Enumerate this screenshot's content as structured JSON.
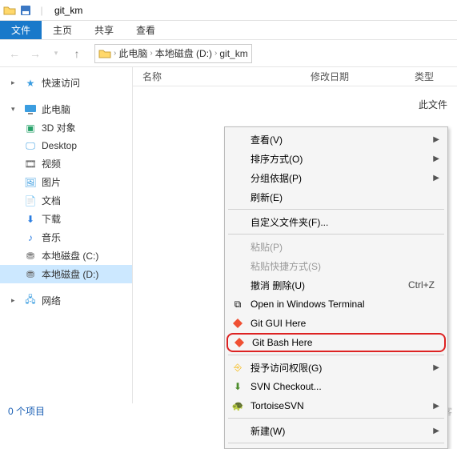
{
  "title": "git_km",
  "ribbon": {
    "file": "文件",
    "home": "主页",
    "share": "共享",
    "view": "查看"
  },
  "breadcrumb": {
    "pc": "此电脑",
    "disk": "本地磁盘 (D:)",
    "folder": "git_km"
  },
  "columns": {
    "name": "名称",
    "date": "修改日期",
    "type": "类型"
  },
  "empty": "此文件",
  "sidebar": {
    "quick": "快速访问",
    "pc": "此电脑",
    "items": [
      "3D 对象",
      "Desktop",
      "视频",
      "图片",
      "文档",
      "下载",
      "音乐",
      "本地磁盘 (C:)",
      "本地磁盘 (D:)"
    ],
    "network": "网络"
  },
  "status": "0 个项目",
  "watermark": "@51CTO博客",
  "menu": {
    "view": "查看(V)",
    "sort": "排序方式(O)",
    "group": "分组依据(P)",
    "refresh": "刷新(E)",
    "custom": "自定义文件夹(F)...",
    "paste": "粘贴(P)",
    "pasteShortcut": "粘贴快捷方式(S)",
    "undo": "撤消 删除(U)",
    "undoKey": "Ctrl+Z",
    "openTerminal": "Open in Windows Terminal",
    "gitGui": "Git GUI Here",
    "gitBash": "Git Bash Here",
    "grant": "授予访问权限(G)",
    "svnCheckout": "SVN Checkout...",
    "tortoise": "TortoiseSVN",
    "new": "新建(W)"
  }
}
